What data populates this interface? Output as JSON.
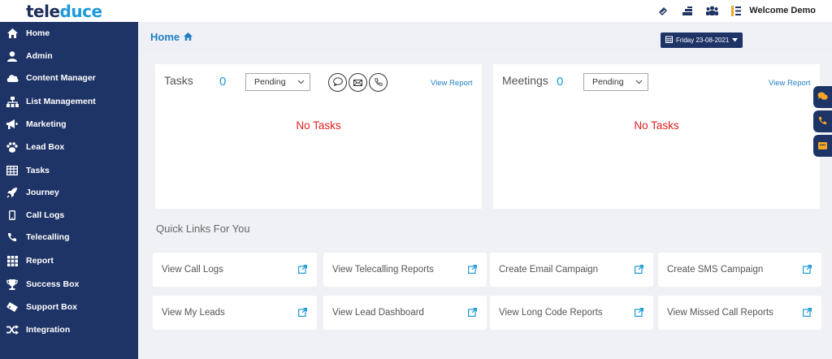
{
  "brand": {
    "part1": "tele",
    "part2": "duce"
  },
  "topbar": {
    "icons": [
      "link-icon",
      "report-icon",
      "users-icon",
      "menu-icon"
    ],
    "welcome": "Welcome Demo"
  },
  "sidebar": {
    "items": [
      {
        "label": "Home",
        "icon": "home-icon"
      },
      {
        "label": "Admin",
        "icon": "user-icon"
      },
      {
        "label": "Content Manager",
        "icon": "cloud-icon"
      },
      {
        "label": "List Management",
        "icon": "sitemap-icon"
      },
      {
        "label": "Marketing",
        "icon": "bullhorn-icon"
      },
      {
        "label": "Lead Box",
        "icon": "paw-icon"
      },
      {
        "label": "Tasks",
        "icon": "table-icon"
      },
      {
        "label": "Journey",
        "icon": "rocket-icon"
      },
      {
        "label": "Call Logs",
        "icon": "mobile-icon"
      },
      {
        "label": "Telecalling",
        "icon": "phone-icon"
      },
      {
        "label": "Report",
        "icon": "grid-icon"
      },
      {
        "label": "Success Box",
        "icon": "trophy-icon"
      },
      {
        "label": "Support Box",
        "icon": "ticket-icon"
      },
      {
        "label": "Integration",
        "icon": "shuffle-icon"
      }
    ]
  },
  "header": {
    "breadcrumb": "Home",
    "date_label": "Friday  23-08-2021"
  },
  "tasks": {
    "title": "Tasks",
    "count": "0",
    "filter": "Pending",
    "view_report": "View Report",
    "empty": "No Tasks"
  },
  "meetings": {
    "title": "Meetings",
    "count": "0",
    "filter": "Pending",
    "view_report": "View Report",
    "empty": "No Tasks"
  },
  "quick_links": {
    "title": "Quick Links For You",
    "items": [
      "View Call Logs",
      "View Telecalling Reports",
      "Create Email Campaign",
      "Create SMS Campaign",
      "View My Leads",
      "View Lead Dashboard",
      "View Long Code Reports",
      "View Missed Call Reports"
    ]
  },
  "colors": {
    "sidebar": "#1f3466",
    "accent": "#1e9ad6",
    "empty_text": "#e0201f",
    "float_icon": "#f5a623"
  }
}
